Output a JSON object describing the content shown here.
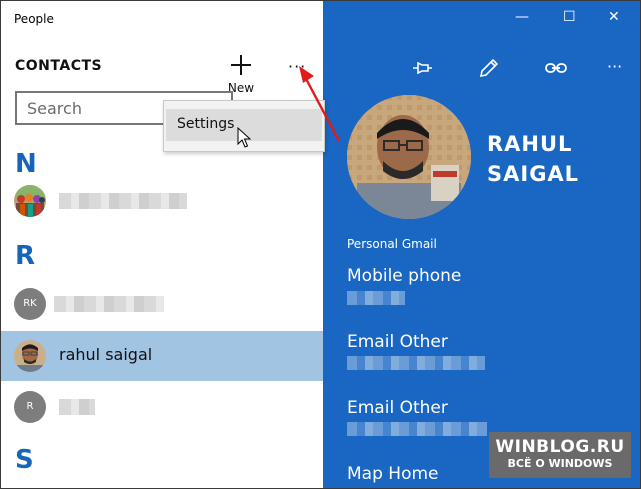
{
  "app": {
    "title": "People"
  },
  "left": {
    "header": "CONTACTS",
    "new_label": "New",
    "more": "···",
    "search_placeholder": "Search"
  },
  "menu": {
    "settings_label": "Settings"
  },
  "groups": [
    {
      "letter": "N"
    },
    {
      "letter": "R"
    },
    {
      "letter": "S"
    }
  ],
  "contacts": [
    {
      "initials": "",
      "name": ""
    },
    {
      "initials": "RK",
      "name": ""
    },
    {
      "initials": "",
      "name": "rahul saigal"
    },
    {
      "initials": "R",
      "name": ""
    }
  ],
  "window_controls": {
    "minimize": "—",
    "maximize": "☐",
    "close": "✕"
  },
  "toolbar": {
    "more": "···"
  },
  "profile": {
    "name_line1": "RAHUL",
    "name_line2": "SAIGAL",
    "account": "Personal Gmail",
    "fields": [
      {
        "label": "Mobile phone"
      },
      {
        "label": "Email Other"
      },
      {
        "label": "Email Other"
      },
      {
        "label": "Map Home"
      }
    ]
  },
  "watermark": {
    "line1": "WINBLOG.RU",
    "line2": "ВСЁ О WINDOWS"
  },
  "colors": {
    "accent": "#1a67c3",
    "letter": "#1565b8",
    "selected": "#a2c4e3"
  }
}
